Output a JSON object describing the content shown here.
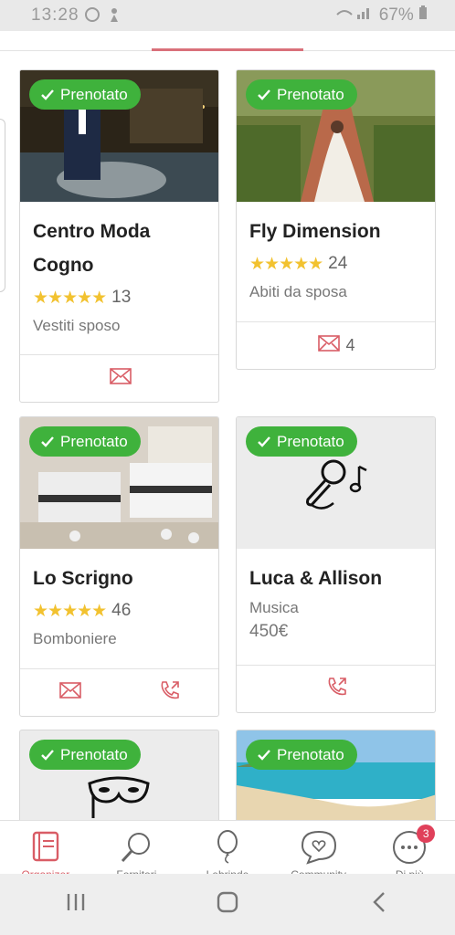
{
  "status": {
    "time": "13:28",
    "battery": "67%"
  },
  "badge_label": "Prenotato",
  "cards": [
    {
      "title_line1": "Centro Moda",
      "title_line2": "Cogno",
      "stars": "★★★★★",
      "reviews": "13",
      "category": "Vestiti sposo"
    },
    {
      "title": "Fly Dimension",
      "stars": "★★★★★",
      "reviews": "24",
      "category": "Abiti da sposa",
      "messages": "4"
    },
    {
      "title": "Lo Scrigno",
      "stars": "★★★★★",
      "reviews": "46",
      "category": "Bomboniere"
    },
    {
      "title": "Luca & Allison",
      "category": "Musica",
      "price": "450€"
    }
  ],
  "bottom_nav": {
    "items": [
      {
        "label": "Organizer",
        "icon": "planner-icon"
      },
      {
        "label": "Fornitori",
        "icon": "search-icon"
      },
      {
        "label": "Lebrinde",
        "icon": "balloon-icon"
      },
      {
        "label": "Community",
        "icon": "chat-heart-icon"
      },
      {
        "label": "Di più",
        "icon": "more-icon"
      }
    ],
    "notification_count": "3"
  },
  "colors": {
    "accent": "#d95d66",
    "badge_green": "#3fb23c",
    "star": "#f2c230"
  }
}
